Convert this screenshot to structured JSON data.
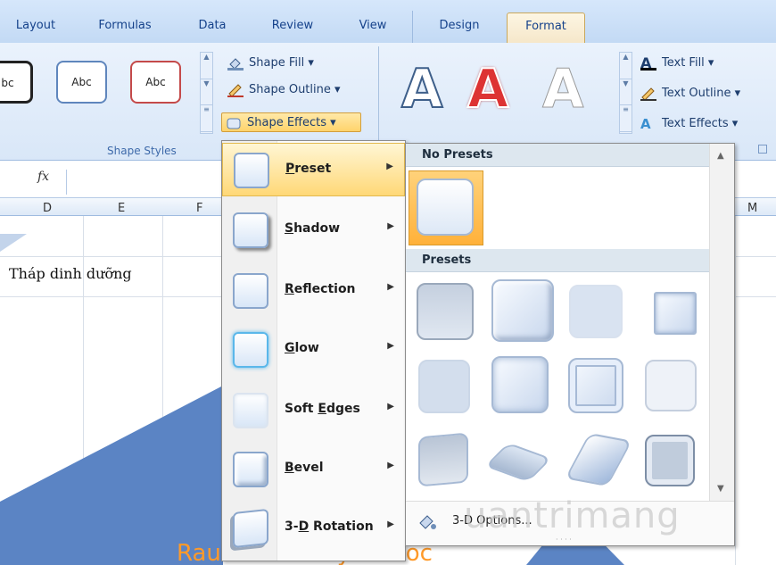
{
  "tabs": [
    "Layout",
    "Formulas",
    "Data",
    "Review",
    "View",
    "Design",
    "Format"
  ],
  "active_tab": "Format",
  "ribbon": {
    "style_boxes": [
      "bc",
      "Abc",
      "Abc"
    ],
    "shape_cmds": [
      "Shape Fill ▾",
      "Shape Outline ▾",
      "Shape Effects ▾"
    ],
    "group_label": "Shape Styles",
    "wordart_letters": [
      "A",
      "A",
      "A"
    ],
    "text_cmds": [
      "Text Fill ▾",
      "Text Outline ▾",
      "Text Effects ▾"
    ]
  },
  "sheet": {
    "fx": "fx",
    "columns": [
      "D",
      "E",
      "F",
      "M"
    ],
    "cell_text": "Tháp dinh dưỡng",
    "bottom_text": "Rau củ trái cây củ cốc"
  },
  "menu": {
    "items": [
      {
        "label": "Preset",
        "underline": "P"
      },
      {
        "label": "Shadow",
        "underline": "S"
      },
      {
        "label": "Reflection",
        "underline": "R"
      },
      {
        "label": "Glow",
        "underline": "G"
      },
      {
        "label": "Soft Edges",
        "underline": "E"
      },
      {
        "label": "Bevel",
        "underline": "B"
      },
      {
        "label": "3-D Rotation",
        "underline": "D"
      }
    ]
  },
  "submenu": {
    "no_presets": "No Presets",
    "presets": "Presets",
    "options": "3-D Options..."
  },
  "watermark": "uantrimang",
  "colors": {
    "accent": "#ffd36b",
    "pyramid": "#4f7fbf"
  }
}
